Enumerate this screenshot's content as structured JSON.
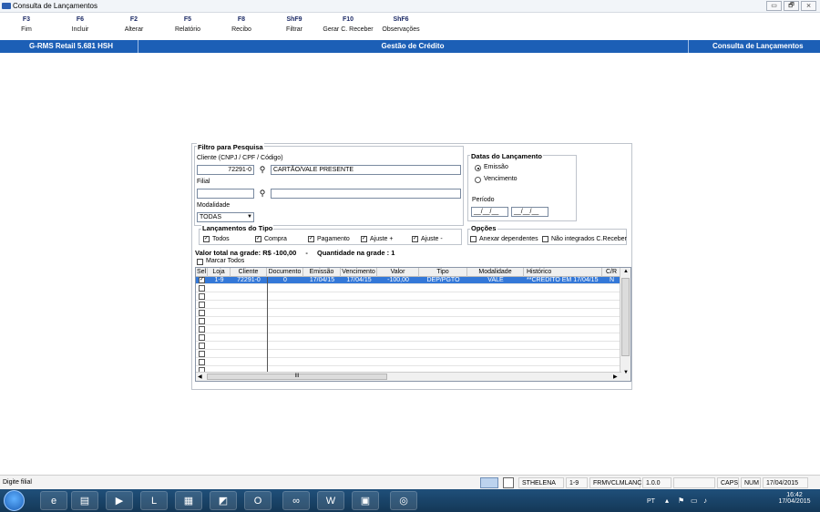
{
  "window": {
    "title": "Consulta de Lançamentos",
    "buttons": [
      "▭",
      "🗗",
      "⨯"
    ]
  },
  "fkeys": [
    {
      "key": "F3",
      "label": "Fim"
    },
    {
      "key": "F6",
      "label": "Incluir"
    },
    {
      "key": "F2",
      "label": "Alterar"
    },
    {
      "key": "F5",
      "label": "Relatório"
    },
    {
      "key": "F8",
      "label": "Recibo"
    },
    {
      "key": "ShF9",
      "label": "Filtrar"
    },
    {
      "key": "F10",
      "label": "Gerar C. Receber"
    },
    {
      "key": "ShF6",
      "label": "Observações"
    }
  ],
  "header": {
    "left": "G-RMS Retail 5.681 HSH",
    "center": "Gestão de Crédito",
    "right": "Consulta de Lançamentos"
  },
  "filtro": {
    "title": "Filtro para Pesquisa",
    "cliente_label": "Cliente (CNPJ / CPF / Código)",
    "cliente_code": "72291-0",
    "cliente_name": "CARTÃO/VALE PRESENTE",
    "filial_label": "Filial",
    "filial_code": "",
    "filial_name": "",
    "modalidade_label": "Modalidade",
    "modalidade_value": "TODAS"
  },
  "datas": {
    "title": "Datas do Lançamento",
    "emissao": "Emissão",
    "vencimento": "Vencimento",
    "periodo_label": "Período",
    "periodo_from": "__/__/__",
    "periodo_to": "__/__/__"
  },
  "tipos": {
    "title": "Lançamentos do Tipo",
    "items": [
      "Todos",
      "Compra",
      "Pagamento",
      "Ajuste +",
      "Ajuste -"
    ]
  },
  "opcoes": {
    "title": "Opções",
    "anexar": "Anexar dependentes",
    "nao_integrados": "Não integrados C.Receber"
  },
  "totals": {
    "valor_label": "Valor total na grade:",
    "valor": "R$ -100,00",
    "dash": "-",
    "qtd_label": "Quantidade na grade :",
    "qtd": "1"
  },
  "marcar_todos": "Marcar Todos",
  "grid": {
    "columns": [
      "Sel",
      "Loja",
      "Cliente",
      "Documento",
      "Emissão",
      "Vencimento",
      "Valor",
      "Tipo",
      "Modalidade",
      "Histórico",
      "C/R"
    ],
    "rows": [
      {
        "sel": "✓",
        "loja": "1-9",
        "cliente": "72291-0",
        "documento": "0",
        "emissao": "17/04/15",
        "vencimento": "17/04/15",
        "valor": "-100,00",
        "tipo": "DEP/PGTO",
        "modalidade": "VALE",
        "historico": "**CREDITO EM 17/04/15",
        "cr": "N"
      }
    ],
    "scroll_hint": "III"
  },
  "status": {
    "message": "Digite filial",
    "user": "STHELENA",
    "loja": "1-9",
    "form": "FRMVCLMLANC",
    "version": "1.0.0",
    "caps": "CAPS",
    "num": "NUM",
    "date": "17/04/2015"
  },
  "taskbar": {
    "lang": "PT",
    "time": "16:42",
    "date": "17/04/2015"
  }
}
